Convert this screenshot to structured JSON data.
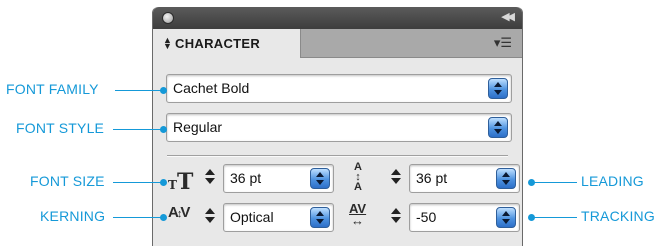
{
  "panel": {
    "tab_title": "CHARACTER",
    "tab_arrows_icon": "updown-arrows-icon",
    "menu_icon": "panel-menu-icon",
    "collapse_icon": "collapse-icon"
  },
  "fields": {
    "font_family": "Cachet Bold",
    "font_style": "Regular",
    "font_size": "36 pt",
    "leading": "36 pt",
    "kerning": "Optical",
    "tracking": "-50"
  },
  "callouts": {
    "font_family": "FONT FAMILY",
    "font_style": "FONT STYLE",
    "font_size": "FONT SIZE",
    "kerning": "KERNING",
    "leading": "LEADING",
    "tracking": "TRACKING"
  },
  "colors": {
    "callout": "#1599d8",
    "dropdown_blue": "#4e93e0",
    "title_bar": "#4a4a4a"
  }
}
